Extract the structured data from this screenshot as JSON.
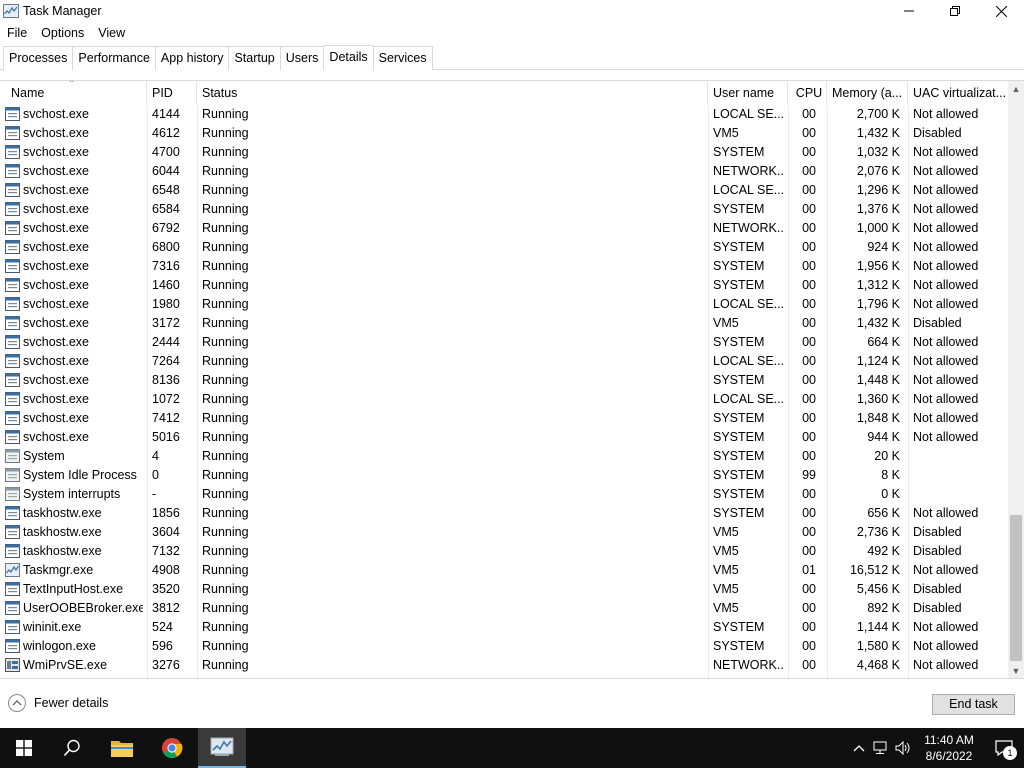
{
  "window": {
    "title": "Task Manager",
    "controls": [
      "minimize",
      "restore",
      "close"
    ]
  },
  "menu": [
    "File",
    "Options",
    "View"
  ],
  "tabs": [
    "Processes",
    "Performance",
    "App history",
    "Startup",
    "Users",
    "Details",
    "Services"
  ],
  "active_tab": "Details",
  "columns": {
    "name": "Name",
    "pid": "PID",
    "status": "Status",
    "user": "User name",
    "cpu": "CPU",
    "memory": "Memory (a...",
    "uac": "UAC virtualizat..."
  },
  "rows": [
    {
      "icon": "service-icon",
      "name": "svchost.exe",
      "pid": "4144",
      "status": "Running",
      "user": "LOCAL SE...",
      "cpu": "00",
      "memory": "2,700 K",
      "uac": "Not allowed"
    },
    {
      "icon": "service-icon",
      "name": "svchost.exe",
      "pid": "4612",
      "status": "Running",
      "user": "VM5",
      "cpu": "00",
      "memory": "1,432 K",
      "uac": "Disabled"
    },
    {
      "icon": "service-icon",
      "name": "svchost.exe",
      "pid": "4700",
      "status": "Running",
      "user": "SYSTEM",
      "cpu": "00",
      "memory": "1,032 K",
      "uac": "Not allowed"
    },
    {
      "icon": "service-icon",
      "name": "svchost.exe",
      "pid": "6044",
      "status": "Running",
      "user": "NETWORK...",
      "cpu": "00",
      "memory": "2,076 K",
      "uac": "Not allowed"
    },
    {
      "icon": "service-icon",
      "name": "svchost.exe",
      "pid": "6548",
      "status": "Running",
      "user": "LOCAL SE...",
      "cpu": "00",
      "memory": "1,296 K",
      "uac": "Not allowed"
    },
    {
      "icon": "service-icon",
      "name": "svchost.exe",
      "pid": "6584",
      "status": "Running",
      "user": "SYSTEM",
      "cpu": "00",
      "memory": "1,376 K",
      "uac": "Not allowed"
    },
    {
      "icon": "service-icon",
      "name": "svchost.exe",
      "pid": "6792",
      "status": "Running",
      "user": "NETWORK...",
      "cpu": "00",
      "memory": "1,000 K",
      "uac": "Not allowed"
    },
    {
      "icon": "service-icon",
      "name": "svchost.exe",
      "pid": "6800",
      "status": "Running",
      "user": "SYSTEM",
      "cpu": "00",
      "memory": "924 K",
      "uac": "Not allowed"
    },
    {
      "icon": "service-icon",
      "name": "svchost.exe",
      "pid": "7316",
      "status": "Running",
      "user": "SYSTEM",
      "cpu": "00",
      "memory": "1,956 K",
      "uac": "Not allowed"
    },
    {
      "icon": "service-icon",
      "name": "svchost.exe",
      "pid": "1460",
      "status": "Running",
      "user": "SYSTEM",
      "cpu": "00",
      "memory": "1,312 K",
      "uac": "Not allowed"
    },
    {
      "icon": "service-icon",
      "name": "svchost.exe",
      "pid": "1980",
      "status": "Running",
      "user": "LOCAL SE...",
      "cpu": "00",
      "memory": "1,796 K",
      "uac": "Not allowed"
    },
    {
      "icon": "service-icon",
      "name": "svchost.exe",
      "pid": "3172",
      "status": "Running",
      "user": "VM5",
      "cpu": "00",
      "memory": "1,432 K",
      "uac": "Disabled"
    },
    {
      "icon": "service-icon",
      "name": "svchost.exe",
      "pid": "2444",
      "status": "Running",
      "user": "SYSTEM",
      "cpu": "00",
      "memory": "664 K",
      "uac": "Not allowed"
    },
    {
      "icon": "service-icon",
      "name": "svchost.exe",
      "pid": "7264",
      "status": "Running",
      "user": "LOCAL SE...",
      "cpu": "00",
      "memory": "1,124 K",
      "uac": "Not allowed"
    },
    {
      "icon": "service-icon",
      "name": "svchost.exe",
      "pid": "8136",
      "status": "Running",
      "user": "SYSTEM",
      "cpu": "00",
      "memory": "1,448 K",
      "uac": "Not allowed"
    },
    {
      "icon": "service-icon",
      "name": "svchost.exe",
      "pid": "1072",
      "status": "Running",
      "user": "LOCAL SE...",
      "cpu": "00",
      "memory": "1,360 K",
      "uac": "Not allowed"
    },
    {
      "icon": "service-icon",
      "name": "svchost.exe",
      "pid": "7412",
      "status": "Running",
      "user": "SYSTEM",
      "cpu": "00",
      "memory": "1,848 K",
      "uac": "Not allowed"
    },
    {
      "icon": "service-icon",
      "name": "svchost.exe",
      "pid": "5016",
      "status": "Running",
      "user": "SYSTEM",
      "cpu": "00",
      "memory": "944 K",
      "uac": "Not allowed"
    },
    {
      "icon": "system-icon",
      "name": "System",
      "pid": "4",
      "status": "Running",
      "user": "SYSTEM",
      "cpu": "00",
      "memory": "20 K",
      "uac": ""
    },
    {
      "icon": "system-icon",
      "name": "System Idle Process",
      "pid": "0",
      "status": "Running",
      "user": "SYSTEM",
      "cpu": "99",
      "memory": "8 K",
      "uac": ""
    },
    {
      "icon": "system-icon",
      "name": "System interrupts",
      "pid": "-",
      "status": "Running",
      "user": "SYSTEM",
      "cpu": "00",
      "memory": "0 K",
      "uac": ""
    },
    {
      "icon": "service-icon",
      "name": "taskhostw.exe",
      "pid": "1856",
      "status": "Running",
      "user": "SYSTEM",
      "cpu": "00",
      "memory": "656 K",
      "uac": "Not allowed"
    },
    {
      "icon": "service-icon",
      "name": "taskhostw.exe",
      "pid": "3604",
      "status": "Running",
      "user": "VM5",
      "cpu": "00",
      "memory": "2,736 K",
      "uac": "Disabled"
    },
    {
      "icon": "service-icon",
      "name": "taskhostw.exe",
      "pid": "7132",
      "status": "Running",
      "user": "VM5",
      "cpu": "00",
      "memory": "492 K",
      "uac": "Disabled"
    },
    {
      "icon": "taskmgr-icon",
      "name": "Taskmgr.exe",
      "pid": "4908",
      "status": "Running",
      "user": "VM5",
      "cpu": "01",
      "memory": "16,512 K",
      "uac": "Not allowed"
    },
    {
      "icon": "service-icon",
      "name": "TextInputHost.exe",
      "pid": "3520",
      "status": "Running",
      "user": "VM5",
      "cpu": "00",
      "memory": "5,456 K",
      "uac": "Disabled"
    },
    {
      "icon": "service-icon",
      "name": "UserOOBEBroker.exe",
      "pid": "3812",
      "status": "Running",
      "user": "VM5",
      "cpu": "00",
      "memory": "892 K",
      "uac": "Disabled"
    },
    {
      "icon": "service-icon",
      "name": "wininit.exe",
      "pid": "524",
      "status": "Running",
      "user": "SYSTEM",
      "cpu": "00",
      "memory": "1,144 K",
      "uac": "Not allowed"
    },
    {
      "icon": "service-icon",
      "name": "winlogon.exe",
      "pid": "596",
      "status": "Running",
      "user": "SYSTEM",
      "cpu": "00",
      "memory": "1,580 K",
      "uac": "Not allowed"
    },
    {
      "icon": "wmi-icon",
      "name": "WmiPrvSE.exe",
      "pid": "3276",
      "status": "Running",
      "user": "NETWORK...",
      "cpu": "00",
      "memory": "4,468 K",
      "uac": "Not allowed"
    }
  ],
  "footer": {
    "fewer_details": "Fewer details",
    "end_task": "End task"
  },
  "taskbar": {
    "apps": [
      "start-icon",
      "search-icon",
      "file-explorer-icon",
      "chrome-icon",
      "task-manager-icon"
    ],
    "time": "11:40 AM",
    "date": "8/6/2022",
    "notification_count": "1"
  },
  "colors": {
    "taskbar_bg": "#101010",
    "active_app_indicator": "#76b9ed",
    "end_task_bg": "#e1e1e1",
    "scrollbar_thumb": "#c2c2c2"
  }
}
